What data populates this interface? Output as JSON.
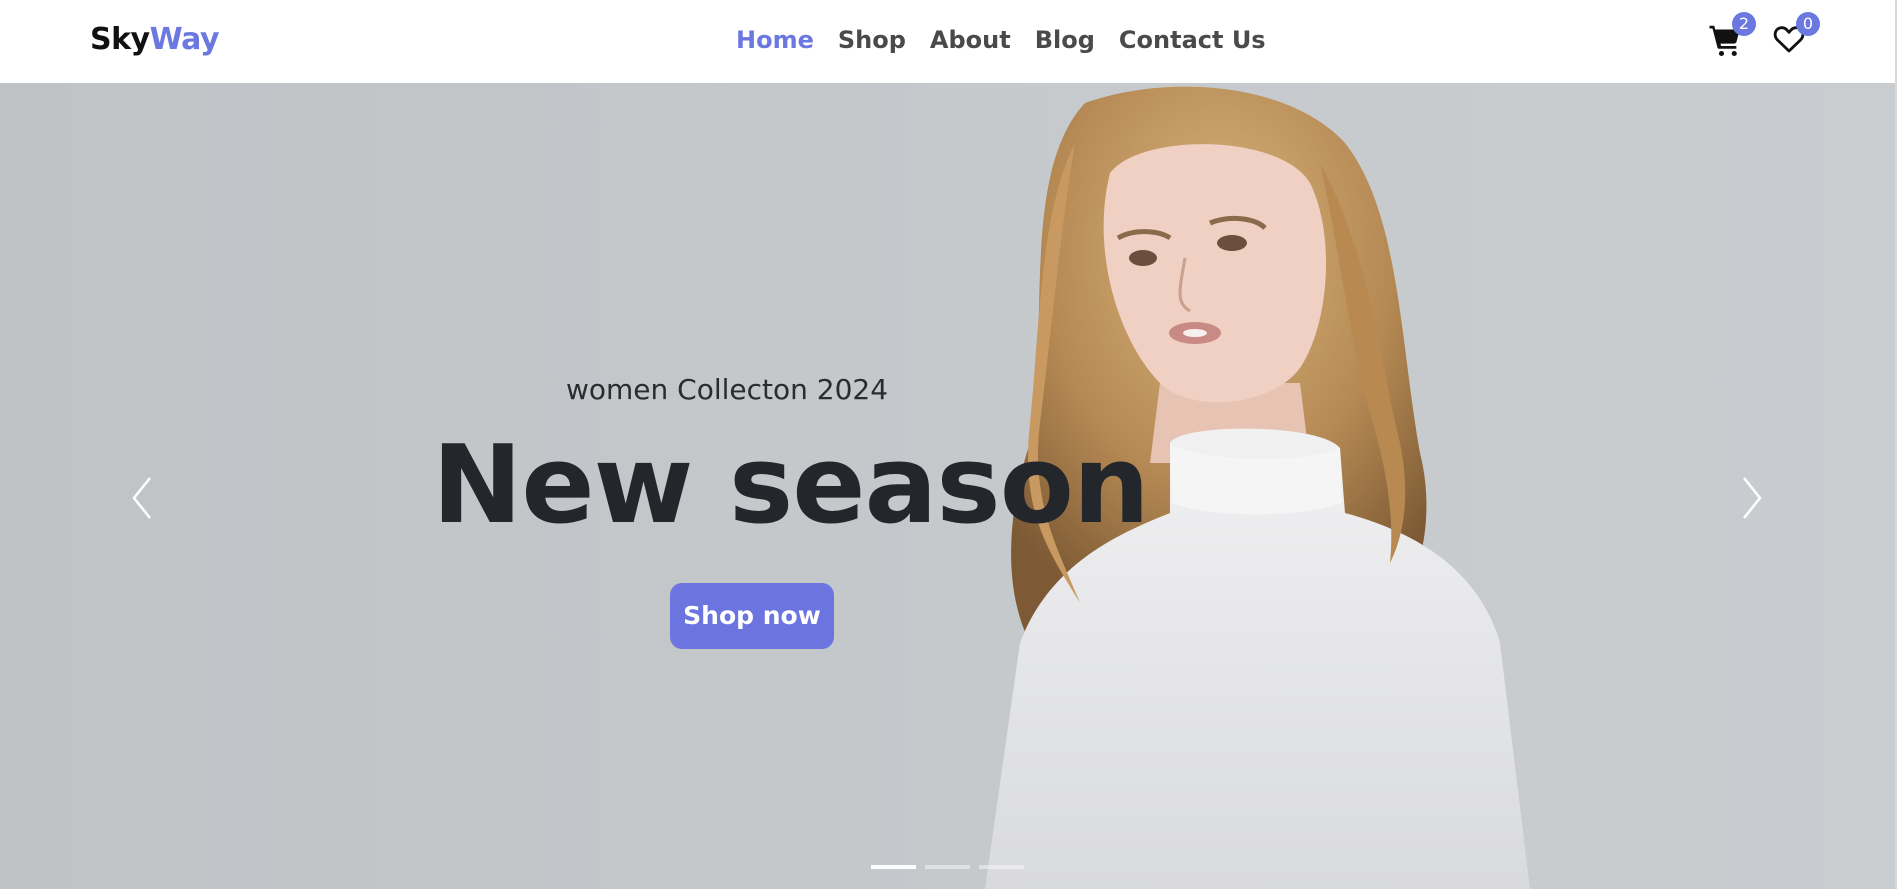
{
  "header": {
    "logo": {
      "part1": "Sky",
      "part2": "Way"
    },
    "nav": [
      {
        "label": "Home",
        "active": true
      },
      {
        "label": "Shop",
        "active": false
      },
      {
        "label": "About",
        "active": false
      },
      {
        "label": "Blog",
        "active": false
      },
      {
        "label": "Contact Us",
        "active": false
      }
    ],
    "cart": {
      "icon": "cart-icon",
      "count": "2"
    },
    "wishlist": {
      "icon": "heart-icon",
      "count": "0"
    }
  },
  "hero": {
    "subtitle": "women Collecton 2024",
    "headline": "New season",
    "cta_label": "Shop now",
    "prev_icon": "chevron-left-icon",
    "next_icon": "chevron-right-icon",
    "slides_total": 3,
    "active_slide": 1
  },
  "colors": {
    "accent": "#6b78e0",
    "button": "#6b74df",
    "hero_bg": "#c3c7ca",
    "text_dark": "#23272b"
  }
}
